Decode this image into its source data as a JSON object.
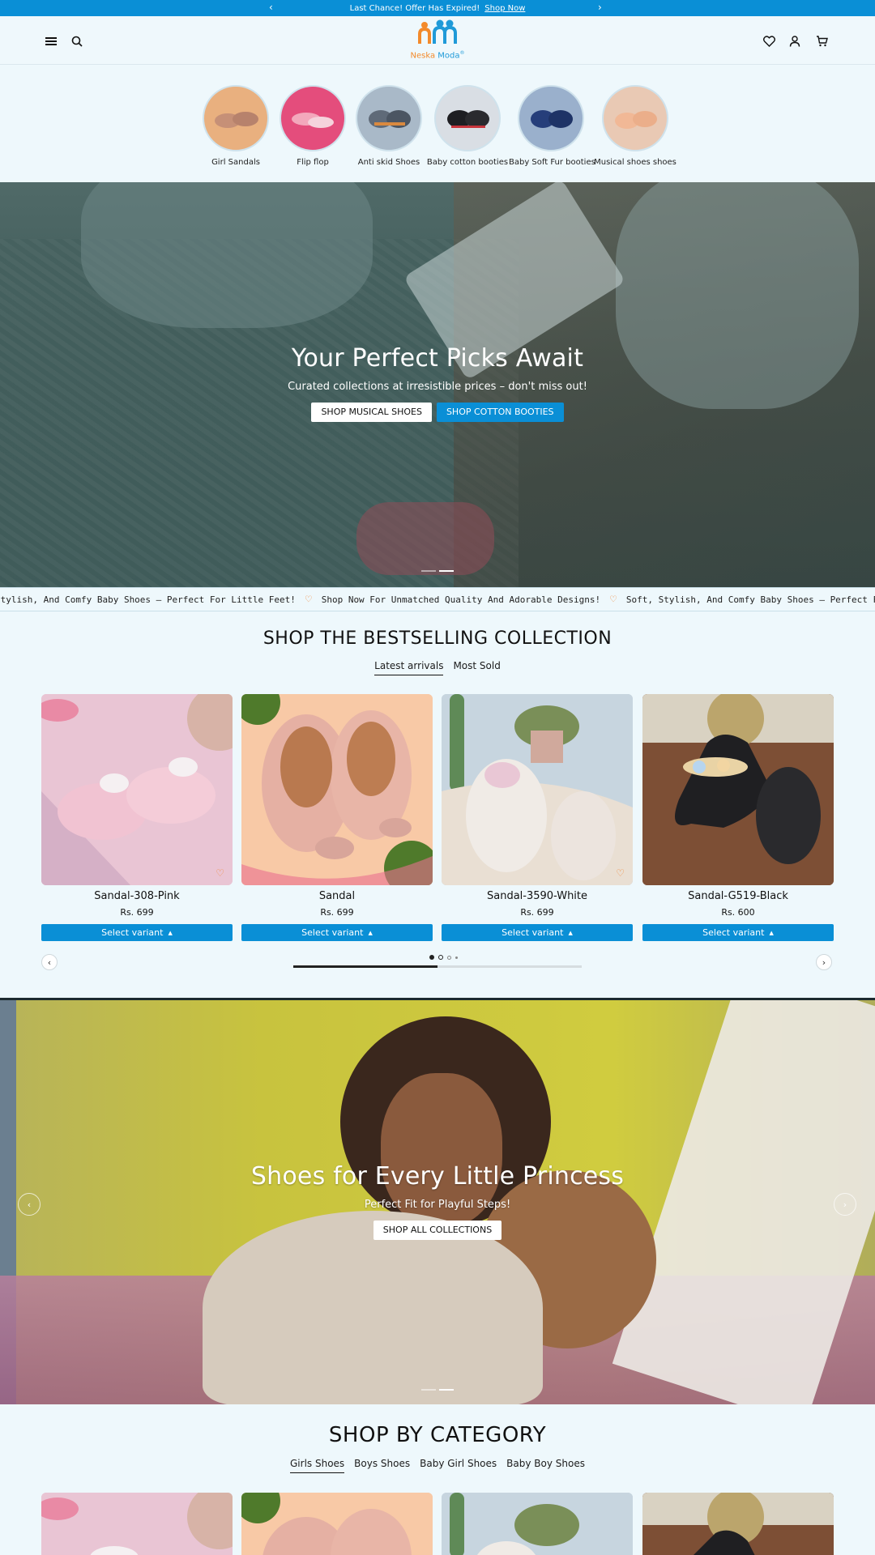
{
  "announcement": {
    "text": "Last Chance!  Offer Has Expired!",
    "link": "Shop Now"
  },
  "header": {
    "logo_text_a": "Neska",
    "logo_text_b": " Moda",
    "logo_mark": "®"
  },
  "categories": [
    {
      "label": "Girl Sandals",
      "color": "#e9b07f"
    },
    {
      "label": "Flip flop",
      "color": "#e44d7c"
    },
    {
      "label": "Anti skid Shoes",
      "color": "#a9b9c8"
    },
    {
      "label": "Baby cotton booties",
      "color": "#d9dee4"
    },
    {
      "label": "Baby Soft Fur booties",
      "color": "#9ab0cc"
    },
    {
      "label": "Musical shoes shoes",
      "color": "#e9c9b4"
    }
  ],
  "hero1": {
    "title": "Your Perfect Picks Await",
    "subtitle": "Curated collections at irresistible prices – don't miss out!",
    "btn1": "SHOP MUSICAL SHOES",
    "btn2": "SHOP COTTON BOOTIES"
  },
  "marquee": [
    "Stylish, And Comfy Baby Shoes – Perfect For Little Feet!",
    "Shop Now For Unmatched Quality And Adorable Designs!",
    "Soft, Stylish, And Comfy Baby Shoes – Perfect For Little Feet!"
  ],
  "bestselling": {
    "title": "SHOP THE BESTSELLING COLLECTION",
    "tabs": [
      "Latest arrivals",
      "Most Sold"
    ],
    "products": [
      {
        "name": "Sandal-308-Pink",
        "price": "Rs. 699",
        "cta": "Select variant",
        "bg": "#e9c5d4",
        "shoe": "#f1c3d2"
      },
      {
        "name": "Sandal",
        "price": "Rs. 699",
        "cta": "Select variant",
        "bg": "#f8c9a6",
        "shoe": "#e7b3a6"
      },
      {
        "name": "Sandal-3590-White",
        "price": "Rs. 699",
        "cta": "Select variant",
        "bg": "#c7d5df",
        "shoe": "#ece8e4"
      },
      {
        "name": "Sandal-G519-Black",
        "price": "Rs. 600",
        "cta": "Select variant",
        "bg": "#8a5b3f",
        "shoe": "#222222"
      }
    ]
  },
  "hero2": {
    "title": "Shoes for Every Little Princess",
    "subtitle": "Perfect Fit for Playful Steps!",
    "btn": "SHOP ALL COLLECTIONS"
  },
  "by_category": {
    "title": "SHOP BY CATEGORY",
    "tabs": [
      "Girls Shoes",
      "Boys Shoes",
      "Baby Girl Shoes",
      "Baby Boy Shoes"
    ]
  },
  "colors": {
    "accent": "#0a8fd6",
    "heart": "#f08a3c",
    "bg": "#eef8fc"
  }
}
